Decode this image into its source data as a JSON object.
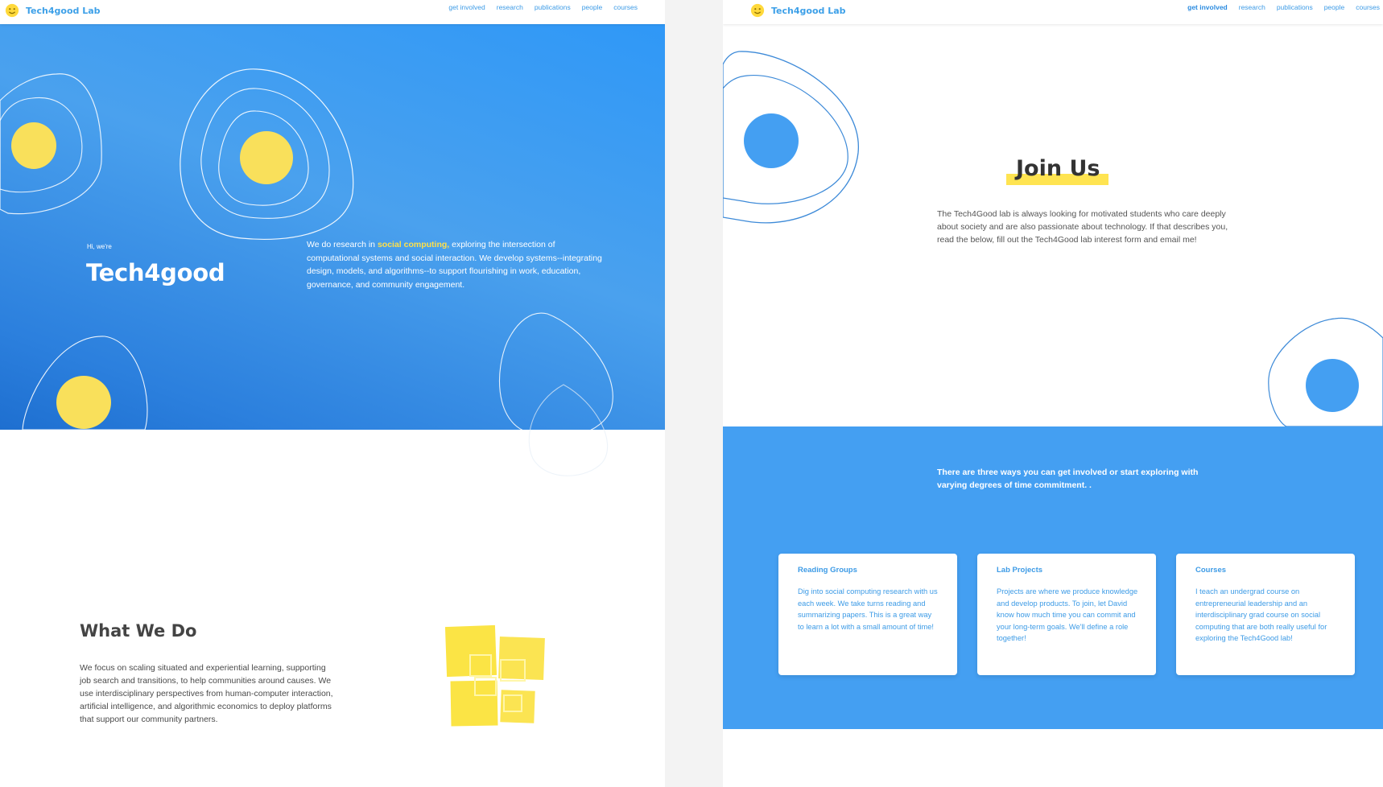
{
  "left": {
    "brand": "Tech4good Lab",
    "nav": [
      "get involved",
      "research",
      "publications",
      "people",
      "courses"
    ],
    "hero": {
      "greeting": "Hi, we're",
      "title": "Tech4good",
      "desc_prefix": "We do research in ",
      "desc_highlight": "social computing,",
      "desc_suffix": " exploring the intersection of computational systems and social interaction.  We develop systems--integrating design, models, and algorithms--to support flourishing in work, education, governance, and community engagement."
    },
    "what_we_do": {
      "title": "What We Do",
      "desc": "We focus on scaling situated and experiential learning, supporting job search and transitions, to help communities around causes. We use interdisciplinary perspectives from human-computer interaction, artificial intelligence, and algorithmic economics to deploy platforms that support our community partners."
    }
  },
  "right": {
    "brand": "Tech4good Lab",
    "nav": [
      "get involved",
      "research",
      "publications",
      "people",
      "courses"
    ],
    "active_nav": "get involved",
    "join": {
      "title": "Join Us",
      "desc": "The Tech4Good lab is always looking for motivated students who care deeply about society and are also passionate about technology. If that describes you, read the below, fill out the Tech4Good lab interest form and email me!"
    },
    "band_text": "There are three ways you can get involved or start exploring with varying degrees of time commitment. .",
    "cards": [
      {
        "title": "Reading Groups",
        "body": "Dig into social computing research with us each week. We take turns reading and summarizing papers. This is a great way to learn a lot with a small amount of time!"
      },
      {
        "title": "Lab Projects",
        "body": "Projects are where we produce knowledge and develop products. To join, let David know how much time you can commit and your long-term goals. We'll define a role together!"
      },
      {
        "title": "Courses",
        "body": "I teach an undergrad course on entrepreneurial leadership and an interdisciplinary grad course on social computing that are both really useful for exploring the Tech4Good lab!"
      }
    ]
  },
  "colors": {
    "accent_blue": "#449ff2",
    "yellow": "#ffe04a",
    "link_blue": "#3d9be6"
  }
}
